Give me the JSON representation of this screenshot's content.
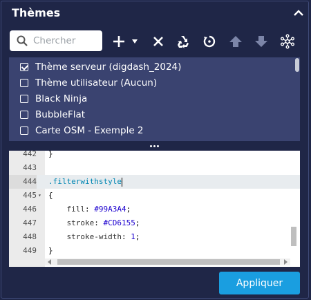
{
  "panel": {
    "title": "Thèmes",
    "collapse_icon": "chevron-up-icon"
  },
  "search": {
    "placeholder": "Chercher",
    "value": ""
  },
  "toolbar": {
    "icons": [
      "plus-icon",
      "dropdown-caret-icon",
      "close-icon",
      "recycle-icon",
      "refresh-icon",
      "move-up-icon",
      "move-down-icon",
      "network-icon"
    ]
  },
  "themes": [
    {
      "label": "Thème serveur (digdash_2024)",
      "checked": true
    },
    {
      "label": "Thème utilisateur (Aucun)",
      "checked": false
    },
    {
      "label": "Black Ninja",
      "checked": false
    },
    {
      "label": "BubbleFlat",
      "checked": false
    },
    {
      "label": "Carte OSM - Exemple 2",
      "checked": false
    }
  ],
  "editor": {
    "lines": [
      {
        "num": "442",
        "text": "}"
      },
      {
        "num": "443",
        "text": ""
      },
      {
        "num": "444",
        "text": ".filterwithstyle"
      },
      {
        "num": "445",
        "text": "{"
      },
      {
        "num": "446",
        "prop": "fill",
        "value": "#99A3A4"
      },
      {
        "num": "447",
        "prop": "stroke",
        "value": "#CD6155"
      },
      {
        "num": "448",
        "prop": "stroke-width",
        "value": "1"
      },
      {
        "num": "449",
        "text": "}"
      }
    ]
  },
  "apply_button": "Appliquer"
}
